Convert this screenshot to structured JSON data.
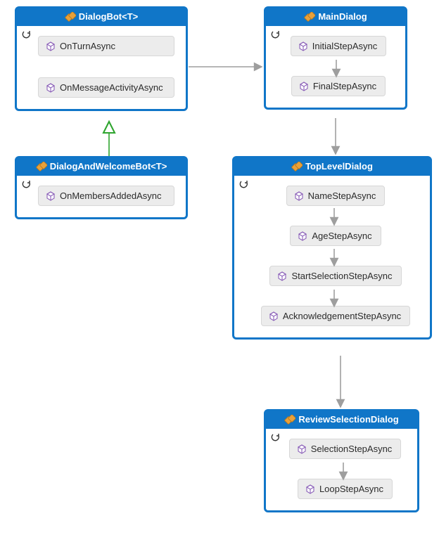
{
  "classes": {
    "dialogBot": {
      "title": "DialogBot<T>",
      "methods": [
        "OnTurnAsync",
        "OnMessageActivityAsync"
      ]
    },
    "dialogAndWelcome": {
      "title": "DialogAndWelcomeBot<T>",
      "methods": [
        "OnMembersAddedAsync"
      ]
    },
    "mainDialog": {
      "title": "MainDialog",
      "methods": [
        "InitialStepAsync",
        "FinalStepAsync"
      ]
    },
    "topLevelDialog": {
      "title": "TopLevelDialog",
      "methods": [
        "NameStepAsync",
        "AgeStepAsync",
        "StartSelectionStepAsync",
        "AcknowledgementStepAsync"
      ]
    },
    "reviewSelectionDialog": {
      "title": "ReviewSelectionDialog",
      "methods": [
        "SelectionStepAsync",
        "LoopStepAsync"
      ]
    }
  },
  "chart_data": {
    "type": "diagram",
    "title": "",
    "nodes": [
      {
        "id": "DialogBot<T>",
        "methods": [
          "OnTurnAsync",
          "OnMessageActivityAsync"
        ],
        "cycle": true
      },
      {
        "id": "DialogAndWelcomeBot<T>",
        "methods": [
          "OnMembersAddedAsync"
        ],
        "cycle": true
      },
      {
        "id": "MainDialog",
        "methods": [
          "InitialStepAsync",
          "FinalStepAsync"
        ],
        "cycle": true
      },
      {
        "id": "TopLevelDialog",
        "methods": [
          "NameStepAsync",
          "AgeStepAsync",
          "StartSelectionStepAsync",
          "AcknowledgementStepAsync"
        ],
        "cycle": true
      },
      {
        "id": "ReviewSelectionDialog",
        "methods": [
          "SelectionStepAsync",
          "LoopStepAsync"
        ],
        "cycle": true
      }
    ],
    "edges": [
      {
        "from": "DialogAndWelcomeBot<T>",
        "to": "DialogBot<T>",
        "type": "inheritance"
      },
      {
        "from": "DialogBot<T>",
        "to": "MainDialog",
        "type": "association"
      },
      {
        "from": "MainDialog",
        "to": "TopLevelDialog",
        "type": "association"
      },
      {
        "from": "TopLevelDialog",
        "to": "ReviewSelectionDialog",
        "type": "association"
      }
    ],
    "internal_flows": [
      {
        "class": "MainDialog",
        "sequence": [
          "InitialStepAsync",
          "FinalStepAsync"
        ]
      },
      {
        "class": "TopLevelDialog",
        "sequence": [
          "NameStepAsync",
          "AgeStepAsync",
          "StartSelectionStepAsync",
          "AcknowledgementStepAsync"
        ]
      },
      {
        "class": "ReviewSelectionDialog",
        "sequence": [
          "SelectionStepAsync",
          "LoopStepAsync"
        ]
      }
    ],
    "colors": {
      "border": "#1076c8",
      "method_bg": "#ececec",
      "inheritance": "#2fa52f",
      "arrow": "#9e9e9e"
    }
  }
}
